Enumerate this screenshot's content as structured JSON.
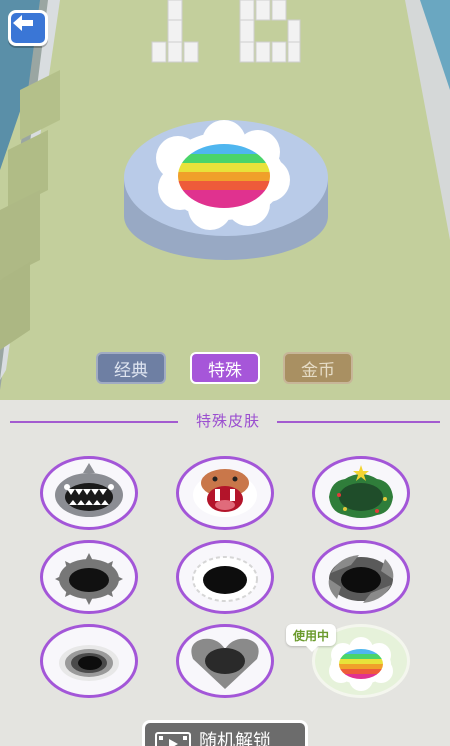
{
  "level_number": "15",
  "mode_tabs": [
    {
      "label": "经典",
      "active": false
    },
    {
      "label": "特殊",
      "active": true
    },
    {
      "label": "金币",
      "active": false
    }
  ],
  "panel": {
    "title": "特殊皮肤",
    "in_use_label": "使用中",
    "random_unlock_label": "随机解锁"
  },
  "skins": [
    {
      "name": "shark"
    },
    {
      "name": "walrus"
    },
    {
      "name": "christmas-tree"
    },
    {
      "name": "gear"
    },
    {
      "name": "snowflake"
    },
    {
      "name": "sawblade"
    },
    {
      "name": "vortex"
    },
    {
      "name": "heart"
    },
    {
      "name": "rainbow",
      "selected": true
    }
  ],
  "colors": {
    "accent": "#a356d8",
    "back_button": "#3a76d6",
    "ground": "#c3cf9c"
  }
}
